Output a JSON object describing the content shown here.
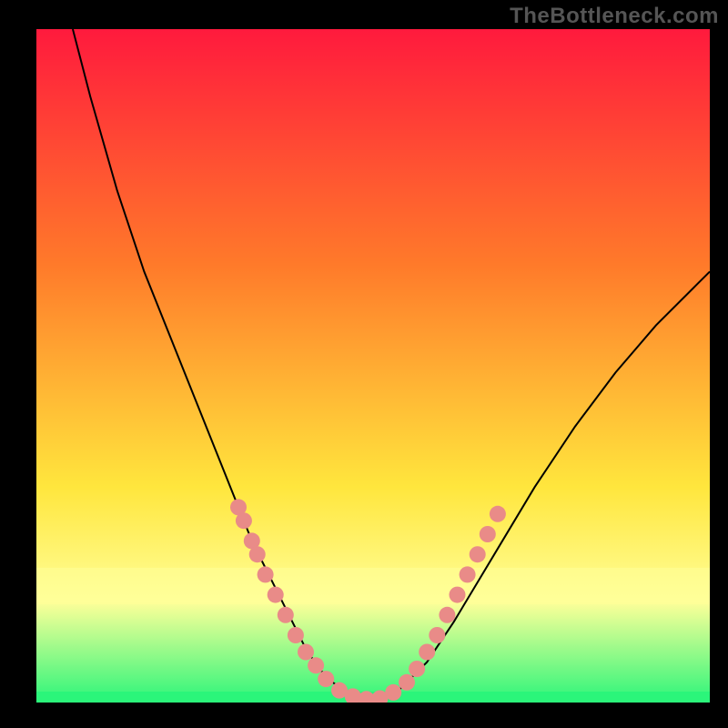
{
  "watermark": "TheBottleneck.com",
  "chart_data": {
    "type": "line",
    "title": "",
    "xlabel": "",
    "ylabel": "",
    "xlim": [
      0,
      100
    ],
    "ylim": [
      0,
      100
    ],
    "grid": false,
    "legend": false,
    "background_gradient": {
      "top_color": "#ff1a3d",
      "upper_mid_color": "#ff7a2a",
      "mid_color": "#ffe63d",
      "lower_band_color": "#ffff99",
      "bottom_color": "#2bf57a"
    },
    "series": [
      {
        "name": "bottleneck-curve",
        "color": "#000000",
        "width": 2,
        "x": [
          5.4,
          8,
          12,
          16,
          20,
          24,
          28,
          30,
          32,
          34,
          36,
          38,
          40,
          42,
          44,
          46,
          50,
          54,
          58,
          62,
          68,
          74,
          80,
          86,
          92,
          98,
          100
        ],
        "y": [
          100,
          90,
          76,
          64,
          54,
          44,
          34,
          29,
          24,
          20,
          16,
          12,
          8,
          5,
          3,
          1.5,
          0.5,
          2,
          6,
          12,
          22,
          32,
          41,
          49,
          56,
          62,
          64
        ]
      }
    ],
    "highlight_points": {
      "name": "flat-region-markers",
      "color": "#e98b88",
      "radius": 3.8,
      "points": [
        {
          "x": 30.0,
          "y": 29.0
        },
        {
          "x": 30.8,
          "y": 27.0
        },
        {
          "x": 32.0,
          "y": 24.0
        },
        {
          "x": 32.8,
          "y": 22.0
        },
        {
          "x": 34.0,
          "y": 19.0
        },
        {
          "x": 35.5,
          "y": 16.0
        },
        {
          "x": 37.0,
          "y": 13.0
        },
        {
          "x": 38.5,
          "y": 10.0
        },
        {
          "x": 40.0,
          "y": 7.5
        },
        {
          "x": 41.5,
          "y": 5.5
        },
        {
          "x": 43.0,
          "y": 3.5
        },
        {
          "x": 45.0,
          "y": 1.8
        },
        {
          "x": 47.0,
          "y": 0.9
        },
        {
          "x": 49.0,
          "y": 0.5
        },
        {
          "x": 51.0,
          "y": 0.6
        },
        {
          "x": 53.0,
          "y": 1.5
        },
        {
          "x": 55.0,
          "y": 3.0
        },
        {
          "x": 56.5,
          "y": 5.0
        },
        {
          "x": 58.0,
          "y": 7.5
        },
        {
          "x": 59.5,
          "y": 10.0
        },
        {
          "x": 61.0,
          "y": 13.0
        },
        {
          "x": 62.5,
          "y": 16.0
        },
        {
          "x": 64.0,
          "y": 19.0
        },
        {
          "x": 65.5,
          "y": 22.0
        },
        {
          "x": 67.0,
          "y": 25.0
        },
        {
          "x": 68.5,
          "y": 28.0
        }
      ]
    }
  }
}
